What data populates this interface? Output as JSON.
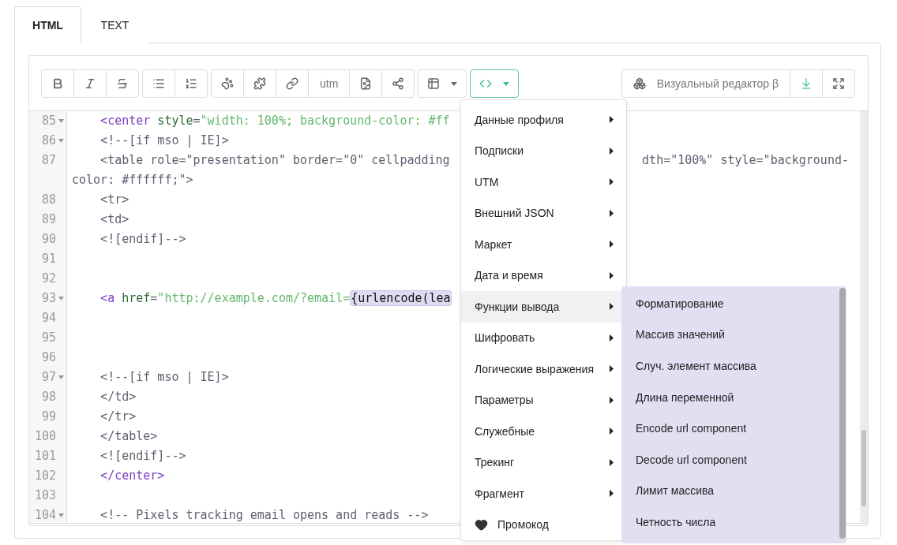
{
  "tabs": [
    {
      "label": "HTML",
      "selected": true
    },
    {
      "label": "TEXT",
      "selected": false
    }
  ],
  "toolbar": {
    "groups": [
      {
        "active": false,
        "buttons": [
          {
            "kind": "bold"
          },
          {
            "kind": "italic"
          },
          {
            "kind": "strike"
          }
        ]
      },
      {
        "active": false,
        "buttons": [
          {
            "kind": "bullets"
          },
          {
            "kind": "numbers"
          }
        ]
      },
      {
        "active": false,
        "buttons": [
          {
            "kind": "paw"
          },
          {
            "kind": "puzzle"
          },
          {
            "kind": "link"
          },
          {
            "kind": "text",
            "label": "utm"
          },
          {
            "kind": "file"
          },
          {
            "kind": "share"
          }
        ]
      },
      {
        "active": false,
        "buttons": [
          {
            "kind": "table",
            "caret": true
          }
        ]
      },
      {
        "active": true,
        "buttons": [
          {
            "kind": "code",
            "caret": true
          }
        ]
      }
    ],
    "right": [
      {
        "kind": "visual",
        "label": "Визуальный редактор β"
      },
      {
        "kind": "download"
      },
      {
        "kind": "expand"
      }
    ]
  },
  "code": {
    "lines": [
      {
        "number": "85",
        "fold": true,
        "tokens": [
          {
            "kind": "tag",
            "text": "<center"
          },
          {
            "kind": "attr",
            "text": " style"
          },
          {
            "kind": "plain",
            "text": "="
          },
          {
            "kind": "string",
            "text": "\"width: 100%; background-color: #ff"
          }
        ]
      },
      {
        "number": "86",
        "fold": true,
        "tokens": [
          {
            "kind": "plain",
            "text": "<!--[if mso | IE]>"
          }
        ]
      },
      {
        "number": "87",
        "fold": false,
        "tokens": [
          {
            "kind": "plain",
            "text": "<table role=\"presentation\" border=\"0\" cellpadding"
          }
        ],
        "right_tokens": [
          {
            "kind": "plain",
            "text": "dth=\"100%\" style=\"background-"
          }
        ],
        "continuation": [
          {
            "kind": "plain",
            "text": "color: #ffffff;\">"
          }
        ]
      },
      {
        "number": "88",
        "fold": false,
        "tokens": [
          {
            "kind": "plain",
            "text": "<tr>"
          }
        ]
      },
      {
        "number": "89",
        "fold": false,
        "tokens": [
          {
            "kind": "plain",
            "text": "<td>"
          }
        ]
      },
      {
        "number": "90",
        "fold": false,
        "tokens": [
          {
            "kind": "plain",
            "text": "<![endif]-->"
          }
        ]
      },
      {
        "number": "91",
        "fold": false
      },
      {
        "number": "92",
        "fold": false
      },
      {
        "number": "93",
        "fold": true,
        "tokens": [
          {
            "kind": "tag",
            "text": "<a"
          },
          {
            "kind": "attr",
            "text": " href"
          },
          {
            "kind": "plain",
            "text": "="
          },
          {
            "kind": "string",
            "text": "\"http://example.com/?email="
          },
          {
            "kind": "highlight",
            "text": "{urlencode(lea"
          }
        ]
      },
      {
        "number": "94",
        "fold": false
      },
      {
        "number": "95",
        "fold": false
      },
      {
        "number": "96",
        "fold": false
      },
      {
        "number": "97",
        "fold": true,
        "tokens": [
          {
            "kind": "plain",
            "text": "<!--[if mso | IE]>"
          }
        ]
      },
      {
        "number": "98",
        "fold": false,
        "tokens": [
          {
            "kind": "plain",
            "text": "</td>"
          }
        ]
      },
      {
        "number": "99",
        "fold": false,
        "tokens": [
          {
            "kind": "plain",
            "text": "</tr>"
          }
        ]
      },
      {
        "number": "100",
        "fold": false,
        "tokens": [
          {
            "kind": "plain",
            "text": "</table>"
          }
        ]
      },
      {
        "number": "101",
        "fold": false,
        "tokens": [
          {
            "kind": "plain",
            "text": "<![endif]-->"
          }
        ]
      },
      {
        "number": "102",
        "fold": false,
        "tokens": [
          {
            "kind": "tag",
            "text": "</center>"
          }
        ]
      },
      {
        "number": "103",
        "fold": false
      },
      {
        "number": "104",
        "fold": true,
        "tokens": [
          {
            "kind": "plain",
            "text": "<!-- Pixels tracking email opens and reads -->"
          }
        ]
      }
    ]
  },
  "menu": {
    "items": [
      {
        "kind": "submenu",
        "label": "Данные профиля",
        "selected": false
      },
      {
        "kind": "submenu",
        "label": "Подписки",
        "selected": false
      },
      {
        "kind": "submenu",
        "label": "UTM",
        "selected": false
      },
      {
        "kind": "submenu",
        "label": "Внешний JSON",
        "selected": false
      },
      {
        "kind": "submenu",
        "label": "Маркет",
        "selected": false
      },
      {
        "kind": "submenu",
        "label": "Дата и время",
        "selected": false
      },
      {
        "kind": "submenu",
        "label": "Функции вывода",
        "selected": true
      },
      {
        "kind": "submenu",
        "label": "Шифровать",
        "selected": false
      },
      {
        "kind": "submenu",
        "label": "Логические выражения",
        "selected": false
      },
      {
        "kind": "submenu",
        "label": "Параметры",
        "selected": false
      },
      {
        "kind": "submenu",
        "label": "Служебные",
        "selected": false
      },
      {
        "kind": "submenu",
        "label": "Трекинг",
        "selected": false
      },
      {
        "kind": "submenu",
        "label": "Фрагмент",
        "selected": false
      },
      {
        "kind": "heart",
        "label": "Промокод",
        "selected": false
      }
    ],
    "submenu": [
      "Форматирование",
      "Массив значений",
      "Случ. элемент массива",
      "Длина переменной",
      "Encode url component",
      "Decode url component",
      "Лимит массива",
      "Четность числа"
    ]
  }
}
